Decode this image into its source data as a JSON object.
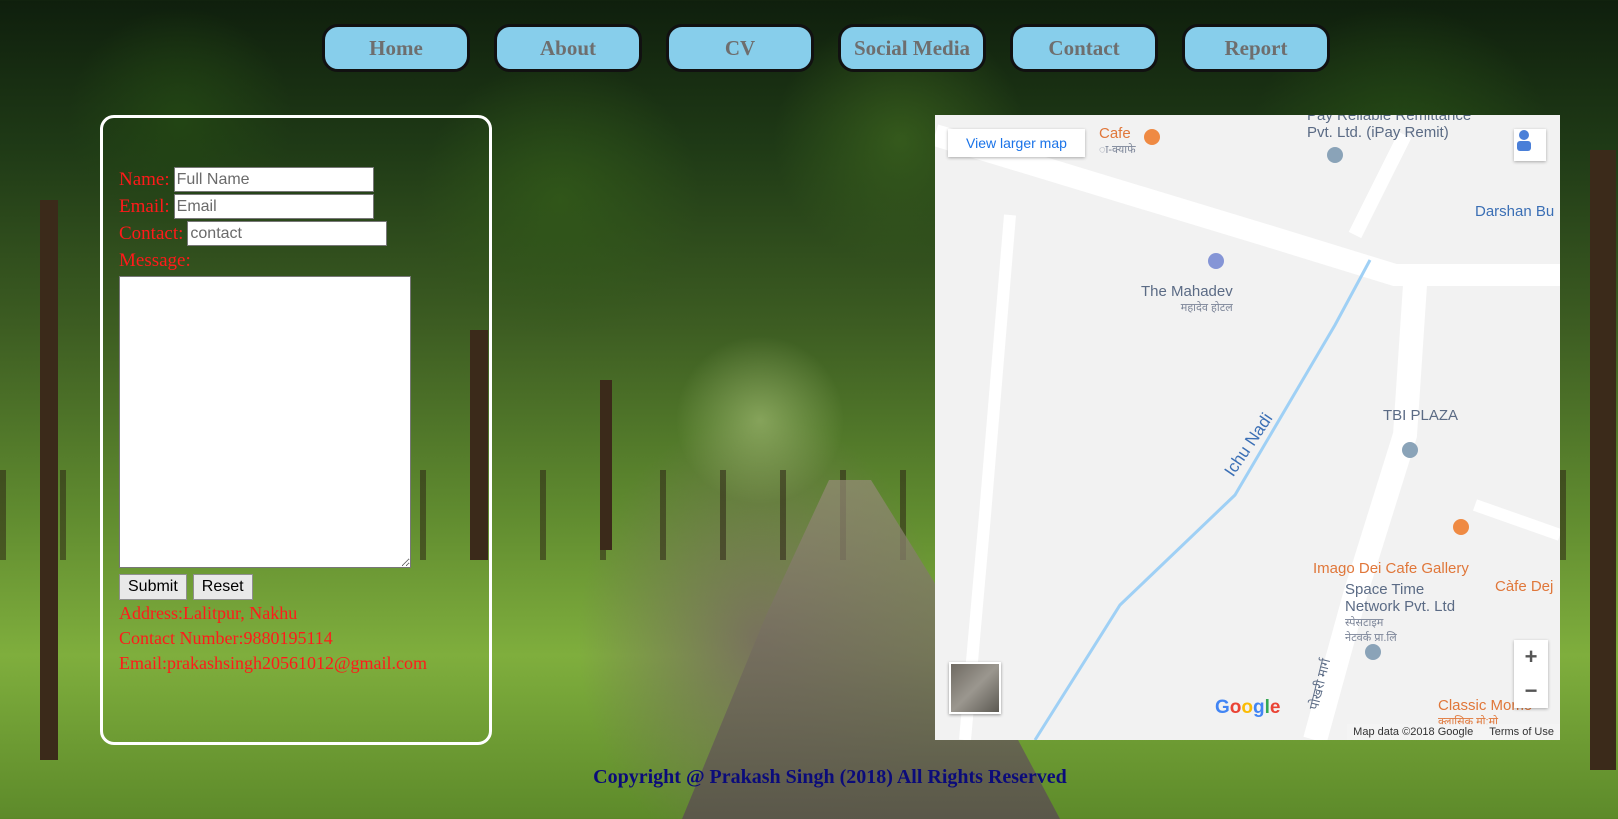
{
  "nav": {
    "items": [
      {
        "label": "Home"
      },
      {
        "label": "About"
      },
      {
        "label": "CV"
      },
      {
        "label": "Social Media"
      },
      {
        "label": "Contact"
      },
      {
        "label": "Report"
      }
    ]
  },
  "form": {
    "name_label": "Name:",
    "name_placeholder": "Full Name",
    "email_label": "Email:",
    "email_placeholder": "Email",
    "contact_label": "Contact:",
    "contact_placeholder": "contact",
    "message_label": "Message:",
    "submit_label": "Submit",
    "reset_label": "Reset"
  },
  "info": {
    "address": "Address:Lalitpur, Nakhu",
    "contact_number": "Contact Number:9880195114",
    "email": "Email:prakashsingh20561012@gmail.com"
  },
  "map": {
    "view_larger": "View larger map",
    "labels": {
      "remit_line1": "Pay Reliable Remittance",
      "remit_line2": "Pvt. Ltd. (iPay Remit)",
      "cafe": "Cafe",
      "cafe_sub": "ा-क्याफे",
      "darshan": "Darshan Bu",
      "mahadev": "The Mahadev",
      "mahadev_sub": "महादेव होटल",
      "river": "Ichu Nadi",
      "tbi": "TBI PLAZA",
      "imago": "Imago Dei Cafe Gallery",
      "cafe_dej": "Càfe Dej",
      "spacetime_1": "Space Time",
      "spacetime_2": "Network Pvt. Ltd",
      "spacetime_sub1": "स्पेसटाइम",
      "spacetime_sub2": "नेटवर्क प्रा.लि",
      "classic": "Classic Momo",
      "classic_sub": "क्लासिक मो:मो",
      "road": "पोखरी मार्ग"
    },
    "google": "Google",
    "map_data": "Map data ©2018 Google",
    "terms": "Terms of Use",
    "zoom_in": "+",
    "zoom_out": "−"
  },
  "footer": {
    "text": "Copyright @ Prakash Singh (2018) All Rights Reserved"
  }
}
